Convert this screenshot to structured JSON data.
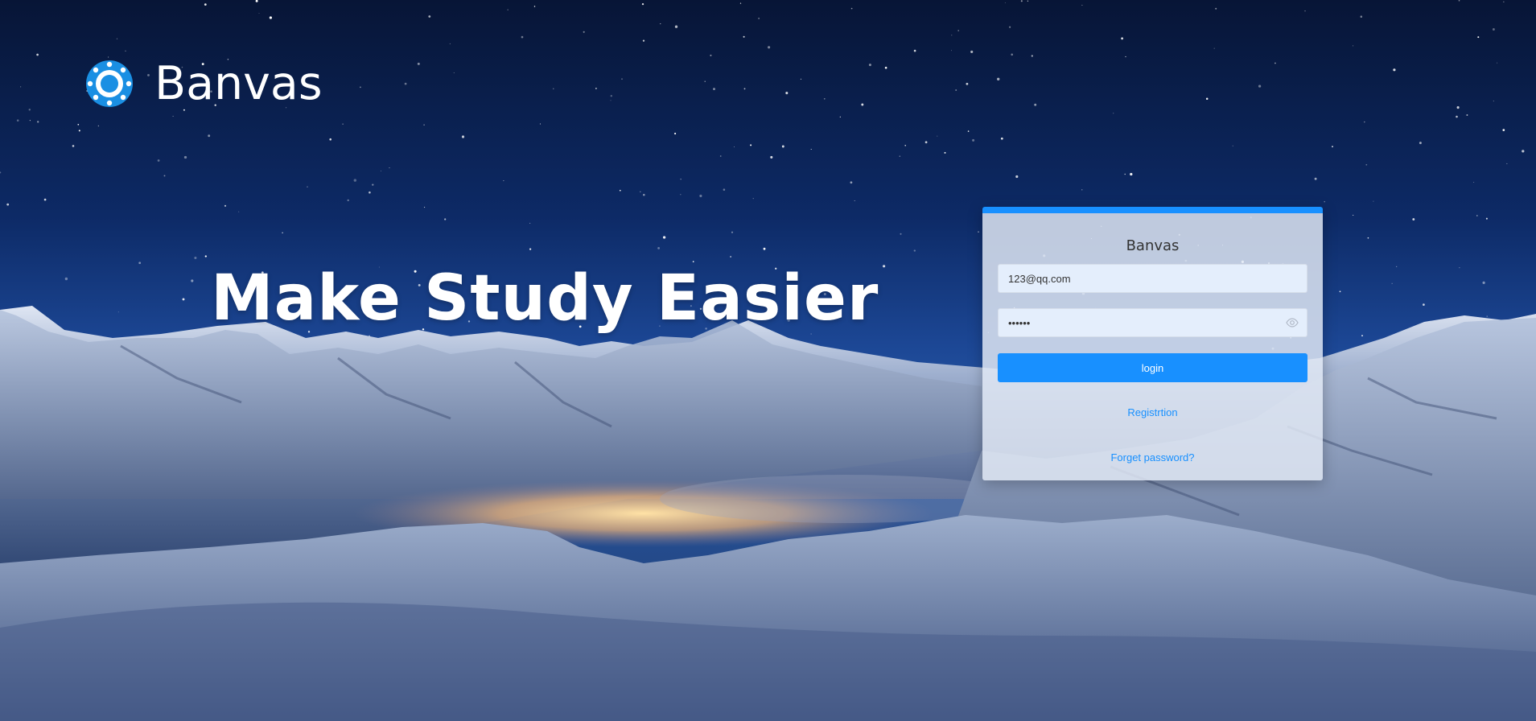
{
  "brand": {
    "name": "Banvas"
  },
  "hero": {
    "headline": "Make Study Easier"
  },
  "login_card": {
    "title": "Banvas",
    "email_value": "123@qq.com",
    "password_value": "123456",
    "login_label": "login",
    "register_label": "Registrtion",
    "forget_label": "Forget password?"
  },
  "colors": {
    "accent": "#1890ff",
    "card_background": "#e1e8f4",
    "input_background": "#e4eefc"
  },
  "icons": [
    "canvas-logo-icon",
    "eye-icon"
  ]
}
